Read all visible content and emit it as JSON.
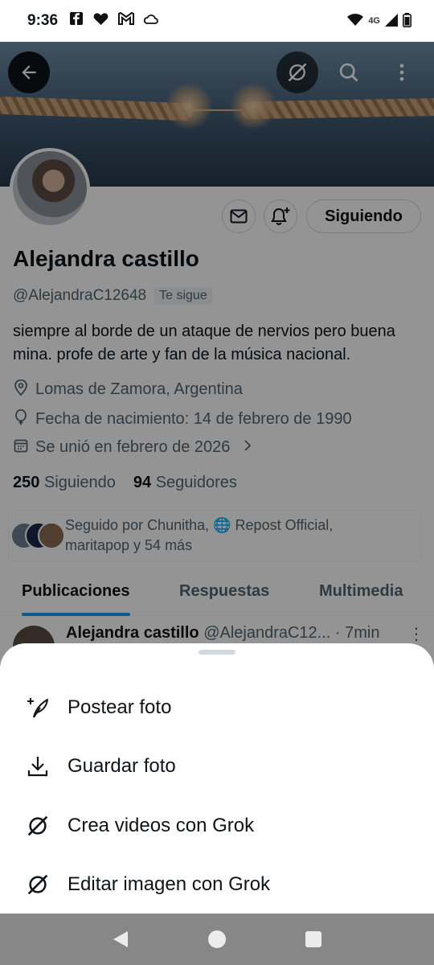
{
  "status_bar": {
    "time": "9:36",
    "network": "4G",
    "left_icons": [
      "facebook-icon",
      "heart-icon",
      "gmail-icon",
      "cloud-icon"
    ],
    "right_icons": [
      "wifi-icon",
      "signal-icon",
      "battery-icon"
    ]
  },
  "profile": {
    "name": "Alejandra castillo",
    "handle": "@AlejandraC12648",
    "follows_you": "Te sigue",
    "bio": "siempre al borde de un ataque de nervios pero buena mina.  profe de arte y fan de la música nacional.",
    "location": "Lomas de Zamora, Argentina",
    "birthday": "Fecha de nacimiento: 14 de febrero de 1990",
    "joined": "Se unió en febrero de 2026",
    "following_count": "250",
    "following_label": "Siguiendo",
    "followers_count": "94",
    "followers_label": "Seguidores",
    "follow_button": "Siguiendo",
    "followed_by_line1": "Seguido por Chunitha, 🌐 Repost Official,",
    "followed_by_line2": "maritapop y 54 más"
  },
  "tabs": [
    {
      "label": "Publicaciones",
      "active": true
    },
    {
      "label": "Respuestas",
      "active": false
    },
    {
      "label": "Multimedia",
      "active": false
    }
  ],
  "post": {
    "author": "Alejandra castillo",
    "handle": "@AlejandraC12...",
    "time": "· 7min"
  },
  "sheet": {
    "items": [
      {
        "label": "Postear foto",
        "icon": "post-photo-icon"
      },
      {
        "label": "Guardar foto",
        "icon": "download-icon"
      },
      {
        "label": "Crea videos con Grok",
        "icon": "grok-icon"
      },
      {
        "label": "Editar imagen con Grok",
        "icon": "grok-icon"
      }
    ]
  },
  "colors": {
    "accent": "#1d9bf0",
    "text": "#0f1419",
    "secondary_text": "#536471",
    "navbar": "#878787"
  }
}
